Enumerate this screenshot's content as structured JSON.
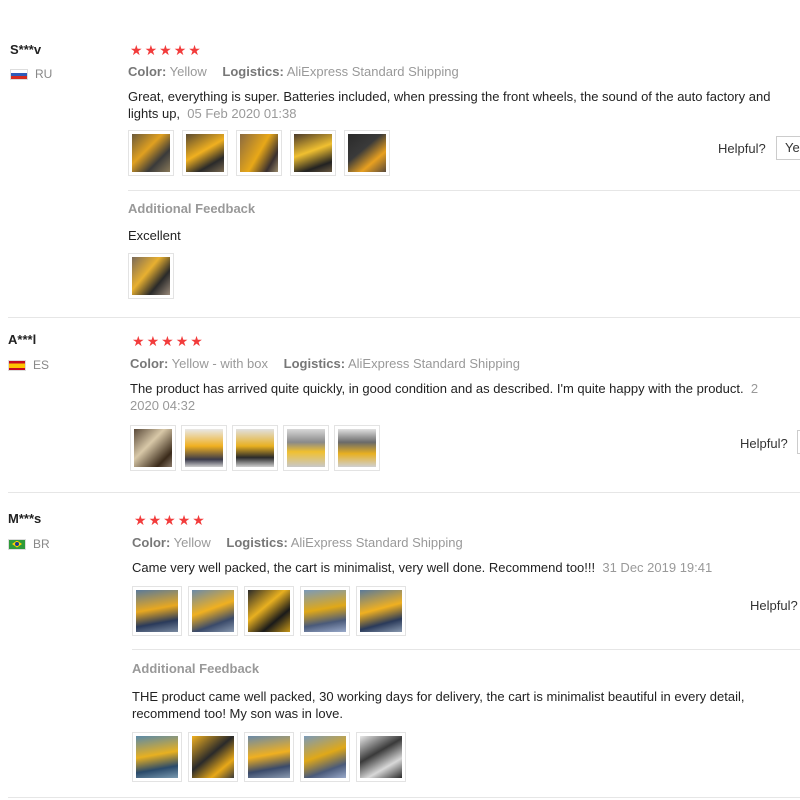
{
  "reviews": [
    {
      "user": "S***v",
      "country": "RU",
      "stars": 5,
      "color_label": "Color:",
      "color_value": "Yellow",
      "logistics_label": "Logistics:",
      "logistics_value": "AliExpress Standard Shipping",
      "text_line1": "Great, everything is super. Batteries included, when pressing the front wheels, the sound of the auto factory and",
      "text_line2": "lights up,",
      "date": "05 Feb 2020 01:38",
      "helpful_label": "Helpful?",
      "yes_label": "Ye",
      "additional_title": "Additional Feedback",
      "additional_text": "Excellent"
    },
    {
      "user": "A***l",
      "country": "ES",
      "stars": 5,
      "color_label": "Color:",
      "color_value": "Yellow - with box",
      "logistics_label": "Logistics:",
      "logistics_value": "AliExpress Standard Shipping",
      "text_line1": "The product has arrived quite quickly, in good condition and as described. I'm quite happy with the product.",
      "date_part1": "2",
      "date_part2": "2020 04:32",
      "helpful_label": "Helpful?"
    },
    {
      "user": "M***s",
      "country": "BR",
      "stars": 5,
      "color_label": "Color:",
      "color_value": "Yellow",
      "logistics_label": "Logistics:",
      "logistics_value": "AliExpress Standard Shipping",
      "text_line1": "Came very well packed, the cart is minimalist, very well done. Recommend too!!!",
      "date": "31 Dec 2019 19:41",
      "helpful_label": "Helpful?",
      "additional_title": "Additional Feedback",
      "additional_line1": "THE product came well packed, 30 working days for delivery, the cart is minimalist beautiful in every detail,",
      "additional_line2": "recommend too! My son was in love."
    }
  ],
  "colors": {
    "star": "#f23c3c",
    "divider": "#e6e6e6",
    "muted": "#999999"
  }
}
